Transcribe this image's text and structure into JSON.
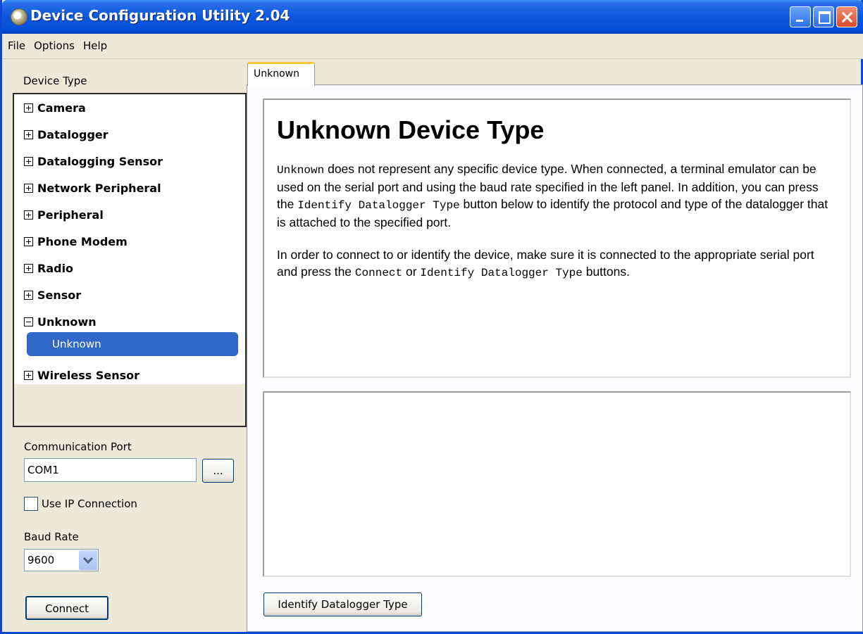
{
  "window": {
    "title": "Device Configuration Utility 2.04"
  },
  "menu": [
    "File",
    "Options",
    "Help"
  ],
  "sidebar": {
    "device_type_label": "Device Type",
    "tree": [
      {
        "label": "Camera",
        "expanded": false
      },
      {
        "label": "Datalogger",
        "expanded": false
      },
      {
        "label": "Datalogging Sensor",
        "expanded": false
      },
      {
        "label": "Network Peripheral",
        "expanded": false
      },
      {
        "label": "Peripheral",
        "expanded": false
      },
      {
        "label": "Phone Modem",
        "expanded": false
      },
      {
        "label": "Radio",
        "expanded": false
      },
      {
        "label": "Sensor",
        "expanded": false
      },
      {
        "label": "Unknown",
        "expanded": true,
        "children": [
          "Unknown"
        ]
      },
      {
        "label": "Wireless Sensor",
        "expanded": false
      }
    ],
    "comm_port_label": "Communication Port",
    "comm_port_value": "COM1",
    "browse_label": "...",
    "use_ip_label": "Use IP Connection",
    "use_ip_checked": false,
    "baud_rate_label": "Baud Rate",
    "baud_rate_value": "9600",
    "connect_label": "Connect"
  },
  "main": {
    "tab_label": "Unknown",
    "heading": "Unknown Device Type",
    "para1": {
      "code1": "Unknown",
      "text1": " does not represent any specific device type. When connected, a terminal emulator can be used on the serial port and using the baud rate specified in the left panel. In addition, you can press the ",
      "code2": "Identify Datalogger Type",
      "text2": " button below to identify the protocol and type of the datalogger that is attached to the specified port."
    },
    "para2": {
      "text1": "In order to connect to or identify the device, make sure it is connected to the appropriate serial port and press the ",
      "code1": "Connect",
      "text2": " or ",
      "code2": "Identify Datalogger Type",
      "text3": " buttons."
    },
    "identify_label": "Identify Datalogger Type"
  },
  "colors": {
    "titlebar": "#0b57dc",
    "selection": "#3167c6",
    "window_bg": "#ece9d8",
    "tab_accent": "#ffc83c"
  }
}
